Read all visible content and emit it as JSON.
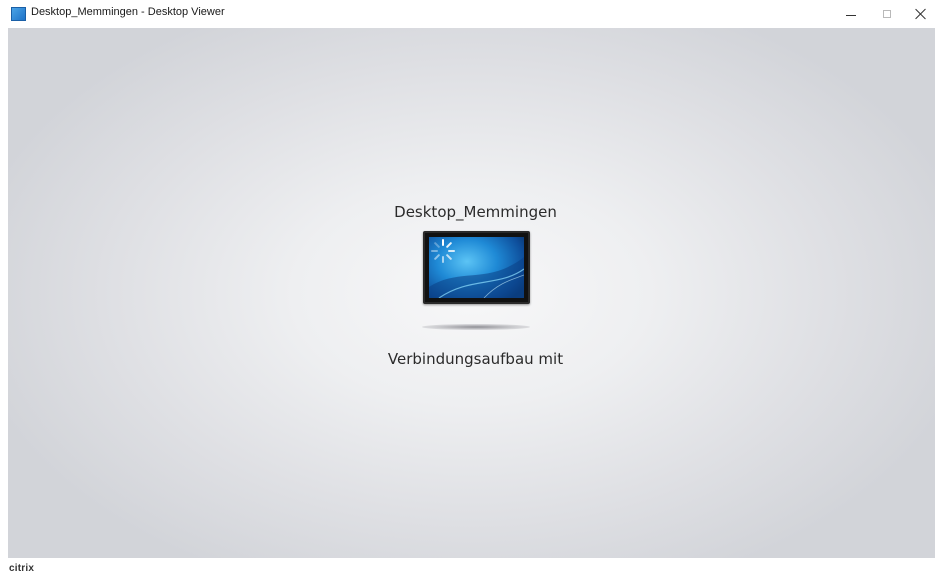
{
  "window": {
    "title": "Desktop_Memmingen - Desktop Viewer",
    "icon": "desktop-viewer-app-icon",
    "controls": {
      "minimize_icon": "minimize-icon",
      "maximize_icon": "maximize-icon",
      "close_icon": "close-icon"
    }
  },
  "viewer": {
    "desktop_name": "Desktop_Memmingen",
    "status": "Verbindungsaufbau mit",
    "monitor_icon": "monitor-connecting-icon",
    "spinner_icon": "loading-spinner-icon"
  },
  "footer": {
    "logo_text": "CiTRiX"
  },
  "colors": {
    "background_center": "#f7f7f8",
    "background_edge": "#d2d4d9",
    "screen_blue": "#1f8ad6",
    "text": "#2b2b2b"
  }
}
